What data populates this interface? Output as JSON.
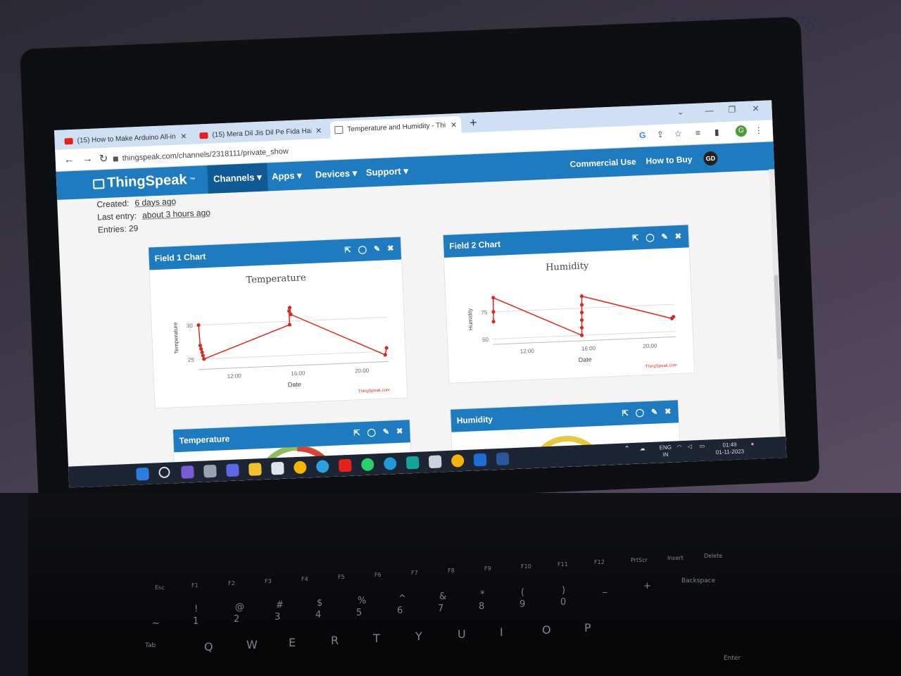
{
  "browser": {
    "tabs": [
      {
        "title": "(15) How to Make Arduino All-in...",
        "icon": "youtube-icon",
        "active": false
      },
      {
        "title": "(15) Mera Dil Jis Dil Pe Fida Hai",
        "icon": "youtube-icon",
        "active": false
      },
      {
        "title": "Temperature and Humidity - Thi",
        "icon": "page-icon",
        "active": true
      }
    ],
    "url": "thingspeak.com/channels/2318111/private_show",
    "profile_initial": "G"
  },
  "site": {
    "logo": "ThingSpeak",
    "logo_tm": "™",
    "menu": [
      "Channels",
      "Apps",
      "Devices",
      "Support"
    ],
    "right_links": [
      "Commercial Use",
      "How to Buy"
    ],
    "user_initials": "GD"
  },
  "channel": {
    "created_label": "Created:",
    "created_value": "6 days ago",
    "last_entry_label": "Last entry:",
    "last_entry_value": "about 3 hours ago",
    "entries_label": "Entries:",
    "entries_value": "29"
  },
  "panels": {
    "field1_title": "Field 1 Chart",
    "field2_title": "Field 2 Chart",
    "gauge1_title": "Temperature",
    "gauge2_title": "Humidity"
  },
  "chart_data": [
    {
      "type": "line",
      "title": "Temperature",
      "xlabel": "Date",
      "ylabel": "Temperature",
      "credit": "ThingSpeak.com",
      "x_ticks": [
        "12:00",
        "16:00",
        "20:00"
      ],
      "y_ticks": [
        25,
        30
      ],
      "xlim": [
        9.8,
        21.7
      ],
      "ylim": [
        23.5,
        33
      ],
      "color": "#d62b1f",
      "x": [
        9.9,
        9.95,
        10.0,
        10.05,
        10.1,
        10.15,
        15.6,
        15.6,
        15.65,
        15.7,
        21.5,
        21.6
      ],
      "y": [
        30.0,
        27.0,
        26.5,
        26.0,
        25.5,
        25.0,
        29.5,
        31.5,
        32.0,
        31.0,
        24.5,
        25.5
      ],
      "grid": true
    },
    {
      "type": "line",
      "title": "Humidity",
      "xlabel": "Date",
      "ylabel": "Humidity",
      "credit": "ThingSpeak.com",
      "x_ticks": [
        "12:00",
        "16:00",
        "20:00"
      ],
      "y_ticks": [
        50,
        75
      ],
      "xlim": [
        9.8,
        21.7
      ],
      "ylim": [
        45,
        93
      ],
      "color": "#d62b1f",
      "x": [
        9.9,
        9.92,
        9.95,
        15.6,
        15.62,
        15.64,
        15.66,
        15.68,
        15.7,
        21.5,
        21.6
      ],
      "y": [
        66.0,
        75.0,
        88.0,
        50.0,
        57.0,
        64.0,
        71.0,
        78.0,
        86.0,
        62.0,
        63.5
      ],
      "grid": true
    }
  ],
  "taskbar": {
    "lang": "ENG",
    "region": "IN",
    "time": "01:49",
    "date": "01-11-2023"
  },
  "keyboard": {
    "fn_row": [
      "Esc",
      "F1",
      "F2",
      "F3",
      "F4",
      "F5",
      "F6",
      "F7",
      "F8",
      "F9",
      "F10",
      "F11",
      "F12",
      "PrtScr",
      "Insert",
      "Delete"
    ],
    "num_symbols": [
      "!",
      "@",
      "#",
      "$",
      "%",
      "^",
      "&",
      "*",
      "(",
      ")",
      "_",
      "+"
    ],
    "num_row": [
      "~",
      "1",
      "2",
      "3",
      "4",
      "5",
      "6",
      "7",
      "8",
      "9",
      "0"
    ],
    "letters": [
      "Tab",
      "Q",
      "W",
      "E",
      "R",
      "T",
      "Y",
      "U",
      "I",
      "O",
      "P"
    ],
    "backspace": "Backspace",
    "enter": "Enter"
  },
  "wall_note": "(1.01)³⁶⁵ = 37.78",
  "colors": {
    "brand": "#1f7bbf",
    "line": "#d62b1f",
    "active_menu": "#0f5a94"
  }
}
